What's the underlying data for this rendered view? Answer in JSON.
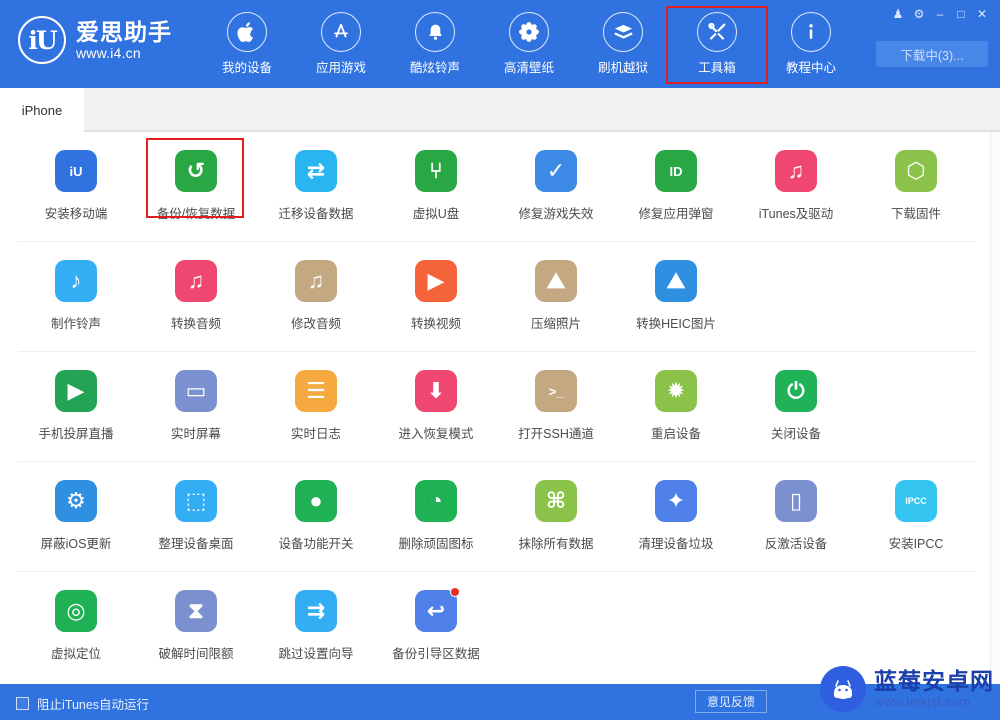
{
  "app": {
    "logo_mark": "iU",
    "logo_name": "爱思助手",
    "logo_url": "www.i4.cn",
    "accent_color": "#2f72e0",
    "highlight_color": "#e02020"
  },
  "nav": {
    "items": [
      {
        "label": "我的设备",
        "icon": "apple-icon",
        "selected": false
      },
      {
        "label": "应用游戏",
        "icon": "appstore-icon",
        "selected": false
      },
      {
        "label": "酷炫铃声",
        "icon": "bell-icon",
        "selected": false
      },
      {
        "label": "高清壁纸",
        "icon": "flower-icon",
        "selected": false
      },
      {
        "label": "刷机越狱",
        "icon": "box-icon",
        "selected": false
      },
      {
        "label": "工具箱",
        "icon": "tools-icon",
        "selected": true
      },
      {
        "label": "教程中心",
        "icon": "info-icon",
        "selected": false
      }
    ]
  },
  "window_controls": [
    {
      "name": "skin-icon",
      "glyph": "♟"
    },
    {
      "name": "settings-gear-icon",
      "glyph": "⚙"
    },
    {
      "name": "minimize-icon",
      "glyph": "–"
    },
    {
      "name": "maximize-icon",
      "glyph": "□"
    },
    {
      "name": "close-icon",
      "glyph": "✕"
    }
  ],
  "download_button": {
    "label": "下载中(3)..."
  },
  "tabs": [
    {
      "label": "iPhone",
      "active": true
    }
  ],
  "toolbox": {
    "rows": [
      {
        "divider": true,
        "items": [
          {
            "label": "安装移动端",
            "icon": "i4-app-icon",
            "color": "#2f72e0",
            "glyph": "iU",
            "highlight": false,
            "badge": false
          },
          {
            "label": "备份/恢复数据",
            "icon": "backup-restore-icon",
            "color": "#29a745",
            "glyph": "↺",
            "highlight": true,
            "badge": false
          },
          {
            "label": "迁移设备数据",
            "icon": "device-migrate-icon",
            "color": "#29b6f0",
            "glyph": "⇄",
            "highlight": false,
            "badge": false
          },
          {
            "label": "虚拟U盘",
            "icon": "usb-drive-icon",
            "color": "#29a745",
            "glyph": "⑂",
            "highlight": false,
            "badge": false
          },
          {
            "label": "修复游戏失效",
            "icon": "fix-game-icon",
            "color": "#3d8ae6",
            "glyph": "✓",
            "highlight": false,
            "badge": false
          },
          {
            "label": "修复应用弹窗",
            "icon": "apple-id-icon",
            "color": "#29a745",
            "glyph": "ID",
            "highlight": false,
            "badge": false
          },
          {
            "label": "iTunes及驱动",
            "icon": "itunes-driver-icon",
            "color": "#ef476f",
            "glyph": "♫",
            "highlight": false,
            "badge": false
          },
          {
            "label": "下载固件",
            "icon": "firmware-box-icon",
            "color": "#8bc34a",
            "glyph": "⬡",
            "highlight": false,
            "badge": false
          }
        ]
      },
      {
        "divider": true,
        "items": [
          {
            "label": "制作铃声",
            "icon": "make-ringtone-icon",
            "color": "#33aef5",
            "glyph": "♪",
            "highlight": false,
            "badge": false
          },
          {
            "label": "转换音频",
            "icon": "convert-audio-icon",
            "color": "#ef476f",
            "glyph": "♫",
            "highlight": false,
            "badge": false
          },
          {
            "label": "修改音频",
            "icon": "edit-audio-icon",
            "color": "#c4a882",
            "glyph": "♫",
            "highlight": false,
            "badge": false
          },
          {
            "label": "转换视频",
            "icon": "convert-video-icon",
            "color": "#f4633a",
            "glyph": "▶",
            "highlight": false,
            "badge": false
          },
          {
            "label": "压缩照片",
            "icon": "compress-photo-icon",
            "color": "#c4a882",
            "glyph": "⛰",
            "highlight": false,
            "badge": false
          },
          {
            "label": "转换HEIC图片",
            "icon": "convert-heic-icon",
            "color": "#2f8fe0",
            "glyph": "⛰",
            "highlight": false,
            "badge": false
          }
        ]
      },
      {
        "divider": true,
        "items": [
          {
            "label": "手机投屏直播",
            "icon": "screen-cast-icon",
            "color": "#23a455",
            "glyph": "▶",
            "highlight": false,
            "badge": false
          },
          {
            "label": "实时屏幕",
            "icon": "live-screen-icon",
            "color": "#7a90cf",
            "glyph": "▭",
            "highlight": false,
            "badge": false
          },
          {
            "label": "实时日志",
            "icon": "live-log-icon",
            "color": "#f5a93f",
            "glyph": "☰",
            "highlight": false,
            "badge": false
          },
          {
            "label": "进入恢复模式",
            "icon": "recovery-mode-icon",
            "color": "#ef476f",
            "glyph": "⬇",
            "highlight": false,
            "badge": false
          },
          {
            "label": "打开SSH通道",
            "icon": "ssh-tunnel-icon",
            "color": "#c4a882",
            "glyph": ">_",
            "highlight": false,
            "badge": false
          },
          {
            "label": "重启设备",
            "icon": "reboot-device-icon",
            "color": "#8bc34a",
            "glyph": "✹",
            "highlight": false,
            "badge": false
          },
          {
            "label": "关闭设备",
            "icon": "power-off-icon",
            "color": "#20b256",
            "glyph": "⏻",
            "highlight": false,
            "badge": false
          }
        ]
      },
      {
        "divider": true,
        "items": [
          {
            "label": "屏蔽iOS更新",
            "icon": "block-ios-update-icon",
            "color": "#2f8fe0",
            "glyph": "⚙",
            "highlight": false,
            "badge": false
          },
          {
            "label": "整理设备桌面",
            "icon": "organize-desktop-icon",
            "color": "#33aef5",
            "glyph": "⬚",
            "highlight": false,
            "badge": false
          },
          {
            "label": "设备功能开关",
            "icon": "feature-toggle-icon",
            "color": "#1fb255",
            "glyph": "●",
            "highlight": false,
            "badge": false
          },
          {
            "label": "删除顽固图标",
            "icon": "delete-icon-icon",
            "color": "#1fb255",
            "glyph": "◔",
            "highlight": false,
            "badge": false
          },
          {
            "label": "抹除所有数据",
            "icon": "erase-all-data-icon",
            "color": "#8bc34a",
            "glyph": "⌘",
            "highlight": false,
            "badge": false
          },
          {
            "label": "清理设备垃圾",
            "icon": "clean-junk-icon",
            "color": "#4f7fe8",
            "glyph": "✦",
            "highlight": false,
            "badge": false
          },
          {
            "label": "反激活设备",
            "icon": "deactivate-device-icon",
            "color": "#7a90cf",
            "glyph": "▯",
            "highlight": false,
            "badge": false
          },
          {
            "label": "安装IPCC",
            "icon": "install-ipcc-icon",
            "color": "#33c5f0",
            "glyph": "IPCC",
            "highlight": false,
            "badge": false
          }
        ]
      },
      {
        "divider": false,
        "items": [
          {
            "label": "虚拟定位",
            "icon": "virtual-location-icon",
            "color": "#1fb255",
            "glyph": "◎",
            "highlight": false,
            "badge": false
          },
          {
            "label": "破解时间限额",
            "icon": "time-limit-icon",
            "color": "#7a90cf",
            "glyph": "⧗",
            "highlight": false,
            "badge": false
          },
          {
            "label": "跳过设置向导",
            "icon": "skip-setup-icon",
            "color": "#33aef5",
            "glyph": "⇉",
            "highlight": false,
            "badge": false
          },
          {
            "label": "备份引导区数据",
            "icon": "backup-boot-icon",
            "color": "#4f7fe8",
            "glyph": "↩",
            "highlight": false,
            "badge": true
          }
        ]
      }
    ]
  },
  "bottom": {
    "checkbox_label": "阻止iTunes自动运行",
    "checkbox_checked": false,
    "feedback_label": "意见反馈"
  },
  "watermark": {
    "name": "蓝莓安卓网",
    "url": "www.lmkjst.com"
  }
}
